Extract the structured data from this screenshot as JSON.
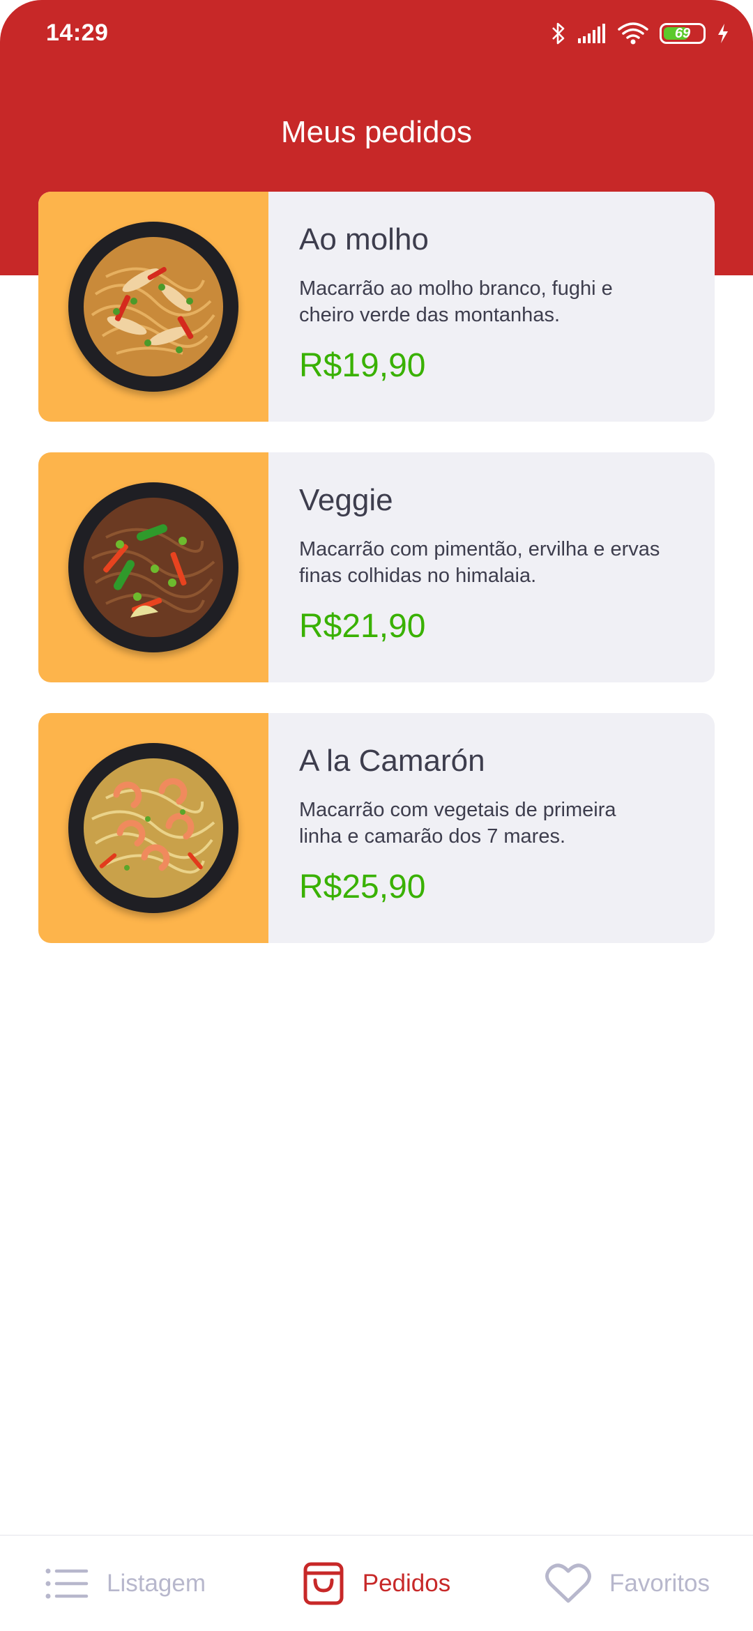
{
  "status_bar": {
    "time": "14:29",
    "battery_level": 69,
    "battery_label": "69",
    "icons": [
      "bluetooth-icon",
      "signal-icon",
      "wifi-icon",
      "battery-icon",
      "charging-icon"
    ]
  },
  "header": {
    "title": "Meus pedidos",
    "background_color": "#c72828"
  },
  "orders": [
    {
      "name": "Ao molho",
      "description": "Macarrão ao molho branco, fughi e cheiro verde das montanhas.",
      "price": "R$19,90",
      "image": "pasta-white-sauce-dish"
    },
    {
      "name": "Veggie",
      "description": "Macarrão com pimentão, ervilha e ervas finas colhidas no himalaia.",
      "price": "R$21,90",
      "image": "veggie-noodles-dish"
    },
    {
      "name": "A la Camarón",
      "description": "Macarrão com vegetais de primeira linha e camarão dos 7 mares.",
      "price": "R$25,90",
      "image": "shrimp-noodles-dish"
    }
  ],
  "tabbar": {
    "tabs": [
      {
        "label": "Listagem",
        "icon": "list-icon",
        "active": false
      },
      {
        "label": "Pedidos",
        "icon": "shopping-bag-icon",
        "active": true
      },
      {
        "label": "Favoritos",
        "icon": "heart-icon",
        "active": false
      }
    ]
  },
  "colors": {
    "primary": "#c72828",
    "thumb_background": "#fdb44b",
    "card_background": "#f0f0f5",
    "price": "#39b100",
    "inactive_tab": "#b7b7cc"
  }
}
